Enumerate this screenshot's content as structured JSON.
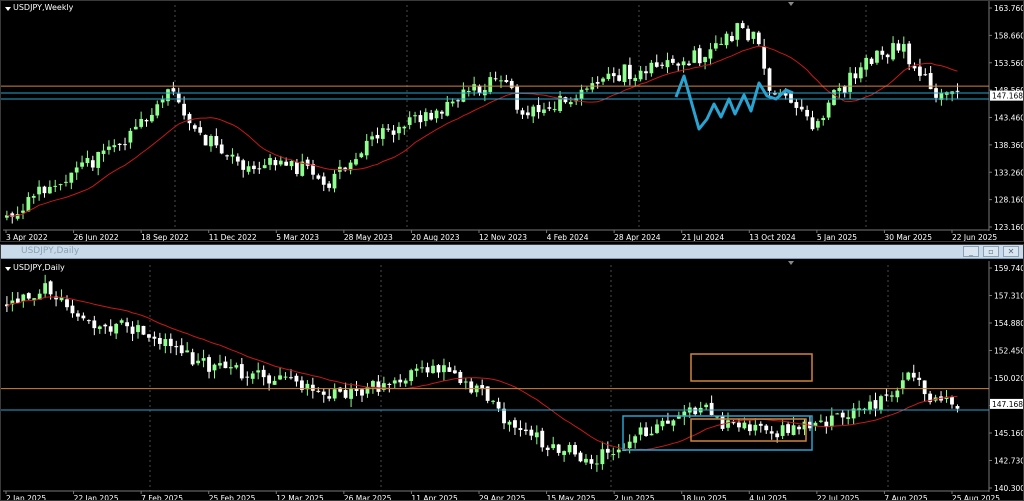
{
  "weekly": {
    "title": "USDJPY,Weekly",
    "price_ticks": [
      "163.760",
      "158.660",
      "153.560",
      "148.560",
      "143.460",
      "138.360",
      "133.260",
      "128.160",
      "123.160"
    ],
    "price_range": [
      120.0,
      165.5
    ],
    "current_price": "147.168",
    "date_labels": [
      "3 Apr 2022",
      "26 Jun 2022",
      "18 Sep 2022",
      "11 Dec 2022",
      "5 Mar 2023",
      "28 May 2023",
      "20 Aug 2023",
      "12 Nov 2023",
      "4 Feb 2024",
      "28 Apr 2024",
      "21 Jul 2024",
      "13 Oct 2024",
      "5 Jan 2025",
      "30 Mar 2025",
      "22 Jun 2025"
    ],
    "orange_level": 149.1,
    "blue_levels": [
      147.7,
      146.5
    ]
  },
  "daily": {
    "title": "USDJPY,Daily",
    "window_title": "USDJPY,Daily",
    "price_ticks": [
      "159.740",
      "157.310",
      "154.880",
      "152.450",
      "150.020",
      "147.590",
      "145.160",
      "142.730",
      "140.300"
    ],
    "price_range": [
      139.0,
      160.2
    ],
    "current_price": "147.168",
    "date_labels": [
      "2 Jan 2025",
      "22 Jan 2025",
      "7 Feb 2025",
      "25 Feb 2025",
      "12 Mar 2025",
      "26 Mar 2025",
      "11 Apr 2025",
      "29 Apr 2025",
      "15 May 2025",
      "2 Jun 2025",
      "18 Jun 2025",
      "4 Jul 2025",
      "22 Jul 2025",
      "7 Aug 2025",
      "25 Aug 2025"
    ],
    "orange_level": 148.6,
    "blue_level": 146.6
  },
  "colors": {
    "bull": "#8fff8f",
    "bear": "#ffffff",
    "ma": "#c81818",
    "grid": "#4a4a4a",
    "orange": "#d0843c",
    "blue": "#29a3d1",
    "text": "#ffffff"
  }
}
